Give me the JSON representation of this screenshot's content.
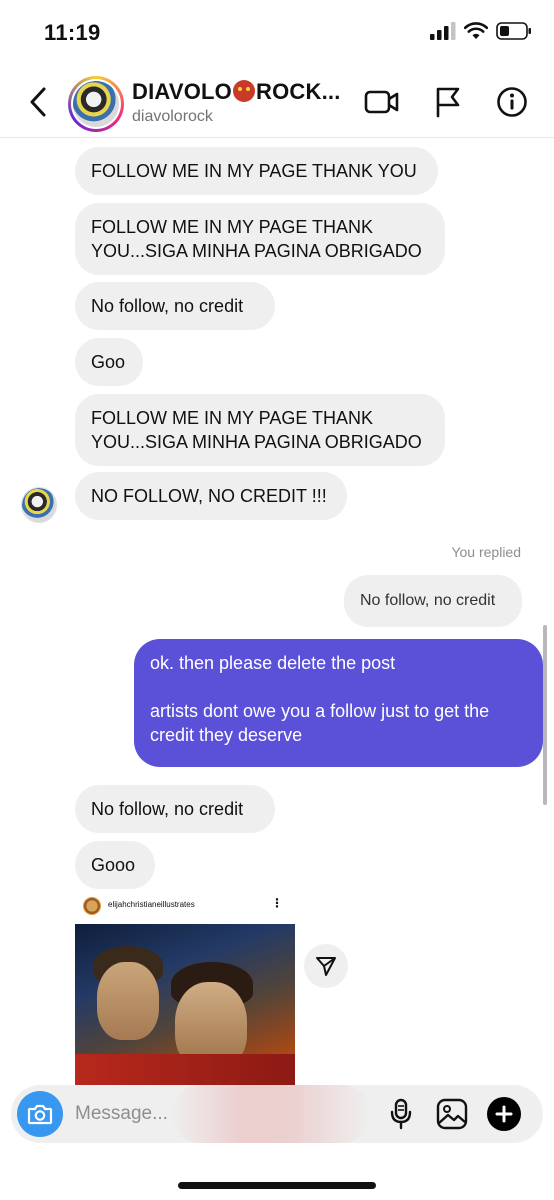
{
  "status_bar": {
    "time": "11:19"
  },
  "header": {
    "display_name": "DIAVOLO",
    "display_name_suffix": "ROCK...",
    "username": "diavolorock",
    "icons": [
      "chevron-left-icon",
      "video-call-icon",
      "flag-icon",
      "info-icon"
    ]
  },
  "messages": [
    {
      "sender": "them",
      "text": "FOLLOW ME IN MY PAGE THANK YOU"
    },
    {
      "sender": "them",
      "text": "FOLLOW ME IN MY PAGE THANK\nYOU...SIGA MINHA PAGINA OBRIGADO"
    },
    {
      "sender": "them",
      "text": "No follow, no credit"
    },
    {
      "sender": "them",
      "text": "Goo"
    },
    {
      "sender": "them",
      "text": "FOLLOW ME IN MY PAGE THANK\nYOU...SIGA MINHA PAGINA OBRIGADO"
    },
    {
      "sender": "them",
      "text": "NO FOLLOW, NO CREDIT !!!"
    },
    {
      "sender": "me",
      "reply_label": "You replied",
      "quoted": "No follow, no credit"
    },
    {
      "sender": "me",
      "text": "ok. then please delete the post\n\nartists dont owe you a follow just to get the credit they deserve"
    },
    {
      "sender": "them",
      "text": "No follow, no credit"
    },
    {
      "sender": "them",
      "text": "Gooo"
    }
  ],
  "shared_post": {
    "username": "elijahchristianeillustrates",
    "more": "⋮"
  },
  "composer": {
    "placeholder": "Message..."
  },
  "colors": {
    "outgoing_bubble": "#5b51d8",
    "incoming_bubble": "#efefef",
    "camera_button": "#3897f0"
  }
}
